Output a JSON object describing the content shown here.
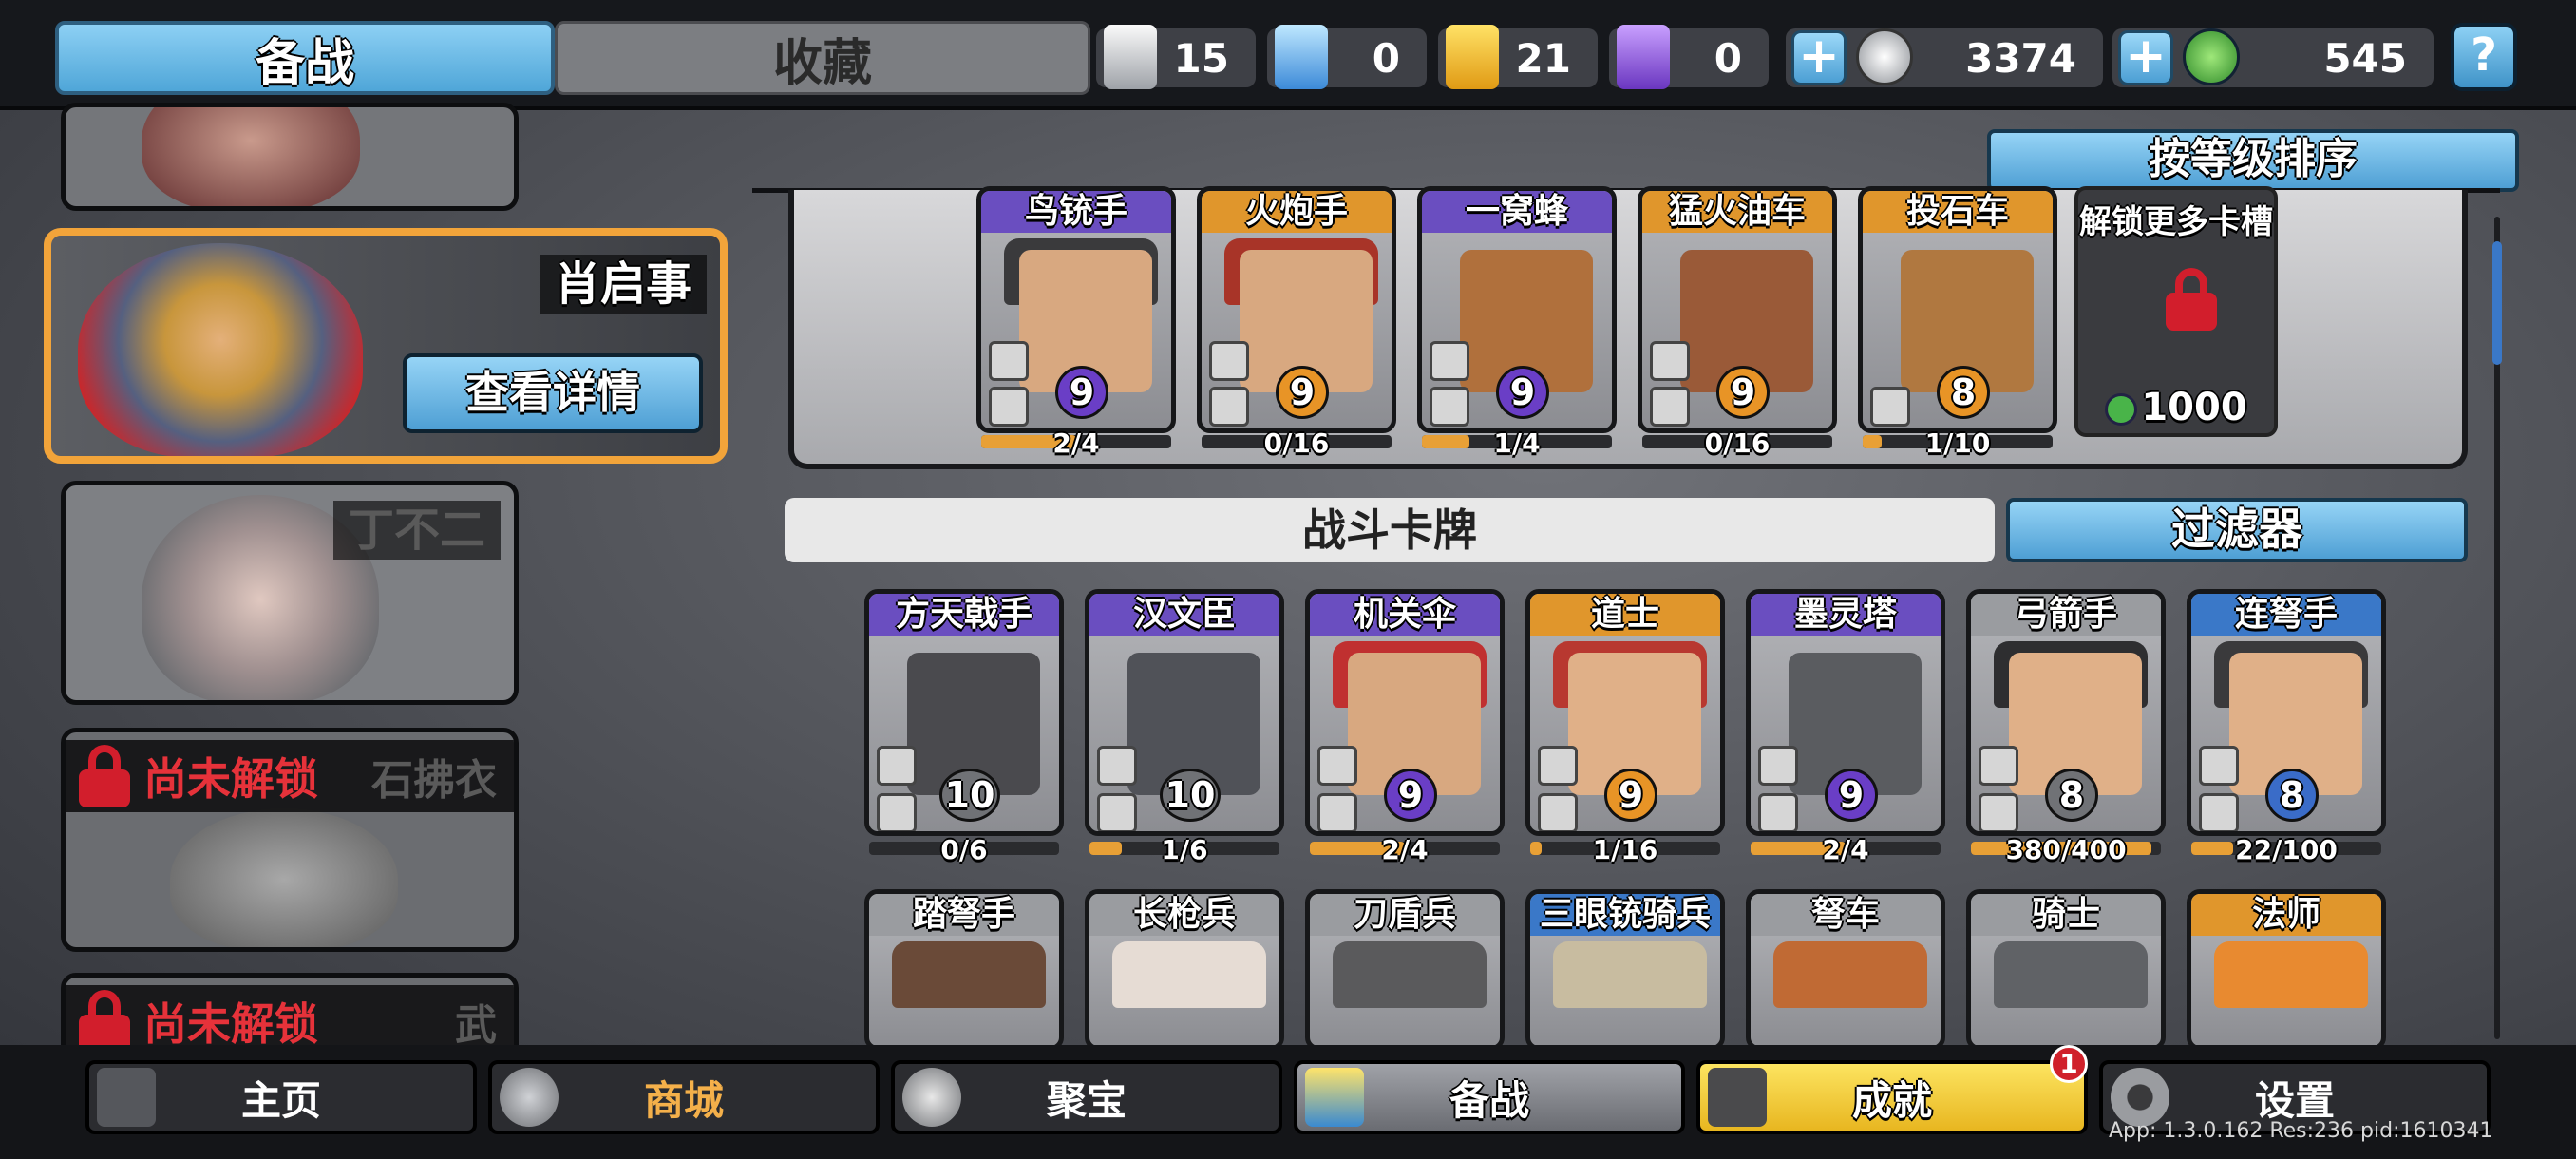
{
  "top_tabs": {
    "prep": "备战",
    "collect": "收藏"
  },
  "resources": [
    {
      "icon": "silver-shield-icon",
      "value": "15"
    },
    {
      "icon": "blue-crystal-icon",
      "value": "0"
    },
    {
      "icon": "gold-shield-icon",
      "value": "21"
    },
    {
      "icon": "purple-crystal-icon",
      "value": "0"
    },
    {
      "icon": "silver-coin-icon",
      "value": "3374"
    },
    {
      "icon": "jade-coin-icon",
      "value": "545"
    }
  ],
  "help": "?",
  "heroes": {
    "selected_name": "肖启事",
    "detail_button": "查看详情",
    "hero2_name": "丁不二",
    "locked_label": "尚未解锁",
    "hero3_name": "石拂衣",
    "hero4_name": "武"
  },
  "sort_button": "按等级排序",
  "deck_cards": [
    {
      "name": "鸟铳手",
      "level": "9",
      "progress": "2/4",
      "fill": 0.5
    },
    {
      "name": "火炮手",
      "level": "9",
      "progress": "0/16",
      "fill": 0.0
    },
    {
      "name": "一窝蜂",
      "level": "9",
      "progress": "1/4",
      "fill": 0.25
    },
    {
      "name": "猛火油车",
      "level": "9",
      "progress": "0/16",
      "fill": 0.0
    },
    {
      "name": "投石车",
      "level": "8",
      "progress": "1/10",
      "fill": 0.1
    }
  ],
  "unlock_slot": {
    "title": "解锁更多卡槽",
    "price": "1000"
  },
  "battle_cards_label": "战斗卡牌",
  "filter_button": "过滤器",
  "battle_cards": [
    {
      "name": "方天戟手",
      "level": "10",
      "progress": "0/6",
      "fill": 0.0
    },
    {
      "name": "汉文臣",
      "level": "10",
      "progress": "1/6",
      "fill": 0.17
    },
    {
      "name": "机关伞",
      "level": "9",
      "progress": "2/4",
      "fill": 0.5
    },
    {
      "name": "道士",
      "level": "9",
      "progress": "1/16",
      "fill": 0.06
    },
    {
      "name": "墨灵塔",
      "level": "9",
      "progress": "2/4",
      "fill": 0.5
    },
    {
      "name": "弓箭手",
      "level": "8",
      "progress": "380/400",
      "fill": 0.95
    },
    {
      "name": "连弩手",
      "level": "8",
      "progress": "22/100",
      "fill": 0.22
    }
  ],
  "battle_cards_row2": [
    "踏弩手",
    "长枪兵",
    "刀盾兵",
    "三眼铳骑兵",
    "弩车",
    "骑士",
    "法师"
  ],
  "nav": {
    "home": "主页",
    "shop": "商城",
    "treasure": "聚宝",
    "prep": "备战",
    "achievements": "成就",
    "settings": "设置",
    "badge": "1"
  },
  "app_info": "App: 1.3.0.162 Res:236 pid:1610341"
}
